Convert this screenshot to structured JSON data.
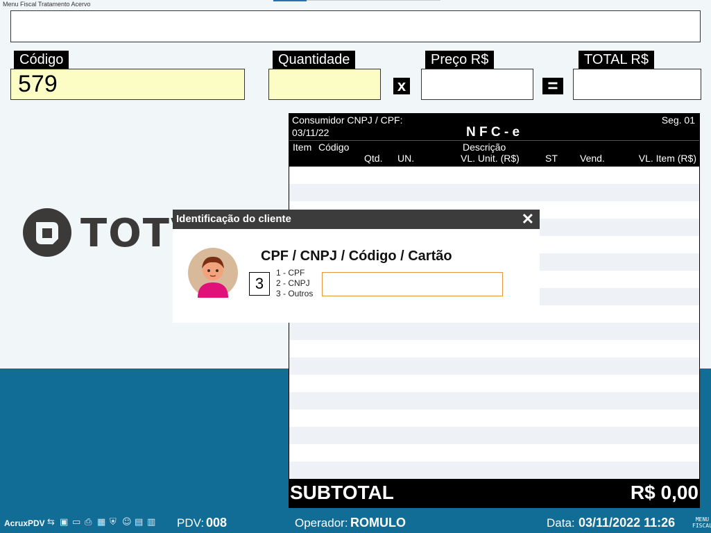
{
  "top_line": "Menu Fiscal Tratamento Acervo",
  "fields": {
    "codigo": {
      "label": "Código",
      "value": "579"
    },
    "quantidade": {
      "label": "Quantidade",
      "value": ""
    },
    "preco": {
      "label": "Preço R$",
      "value": ""
    },
    "total": {
      "label": "TOTAL R$",
      "value": ""
    },
    "times_symbol": "x",
    "equals_symbol": "="
  },
  "logo": {
    "text": "TOTVS",
    "icon": "totvs-logo-icon"
  },
  "nfce": {
    "consumidor_label": "Consumidor CNPJ / CPF:",
    "seg": "Seg. 01",
    "date": "03/11/22",
    "title": "N F C - e",
    "columns": {
      "item": "Item",
      "codigo": "Código",
      "descricao": "Descrição",
      "qtd": "Qtd.",
      "un": "UN.",
      "vl_unit": "VL. Unit. (R$)",
      "st": "ST",
      "vend": "Vend.",
      "vl_item": "VL. Item (R$)"
    }
  },
  "subtotal": {
    "label": "SUBTOTAL",
    "value": "R$ 0,00"
  },
  "dialog": {
    "title": "Identificação do cliente",
    "heading": "CPF / CNPJ / Código / Cartão",
    "option_value": "3",
    "options": [
      "1 - CPF",
      "2 - CNPJ",
      "3 - Outros"
    ],
    "input_value": "",
    "colors": {
      "input_border": "#e8963c",
      "avatar_bg": "#d8b99a",
      "avatar_shirt": "#e0127a"
    }
  },
  "footer": {
    "app": "AcruxPDV",
    "pdv_label": "PDV:",
    "pdv_value": "008",
    "operador_label": "Operador:",
    "operador_value": "ROMULO",
    "data_label": "Data:",
    "data_value": "03/11/2022 11:26",
    "menu_fiscal": [
      "MENU",
      "FISCAL"
    ],
    "tray_icons": [
      "usb-icon",
      "network-icon",
      "monitor-icon",
      "printer-icon",
      "keyboard-icon",
      "shield-icon",
      "user-icon",
      "database-icon",
      "grid-icon"
    ]
  },
  "colors": {
    "band": "#116d96",
    "background": "#f1f6f9",
    "yellow_field": "#fbfdc4"
  }
}
